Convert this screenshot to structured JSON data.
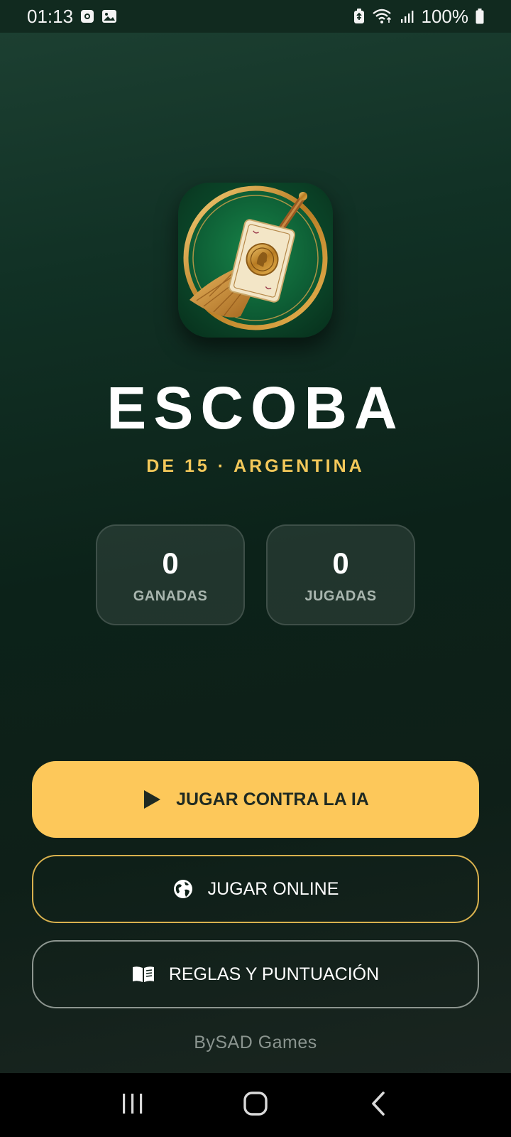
{
  "status_bar": {
    "time": "01:13",
    "battery": "100%",
    "icons": [
      "screen-record-icon",
      "image-icon",
      "battery-saver-icon",
      "wifi-icon",
      "signal-icon",
      "battery-icon"
    ]
  },
  "app": {
    "logo_icon": "escoba-logo-icon",
    "title": "ESCOBA",
    "subtitle": "DE 15 · ARGENTINA",
    "stats": [
      {
        "value": "0",
        "label": "GANADAS"
      },
      {
        "value": "0",
        "label": "JUGADAS"
      }
    ],
    "buttons": {
      "play_ai": {
        "label": "JUGAR CONTRA LA IA",
        "icon": "play-icon"
      },
      "play_online": {
        "label": "JUGAR ONLINE",
        "icon": "globe-icon"
      },
      "rules": {
        "label": "REGLAS Y PUNTUACIÓN",
        "icon": "book-icon"
      }
    },
    "footer": "BySAD Games"
  },
  "nav_bar": {
    "icons": [
      "recents-icon",
      "home-icon",
      "back-icon"
    ]
  },
  "colors": {
    "accent_gold": "#fdc85a",
    "subtitle_gold": "#f3c85a",
    "background_green": "#0f2119",
    "card_bg": "rgba(255,255,255,0.09)"
  }
}
